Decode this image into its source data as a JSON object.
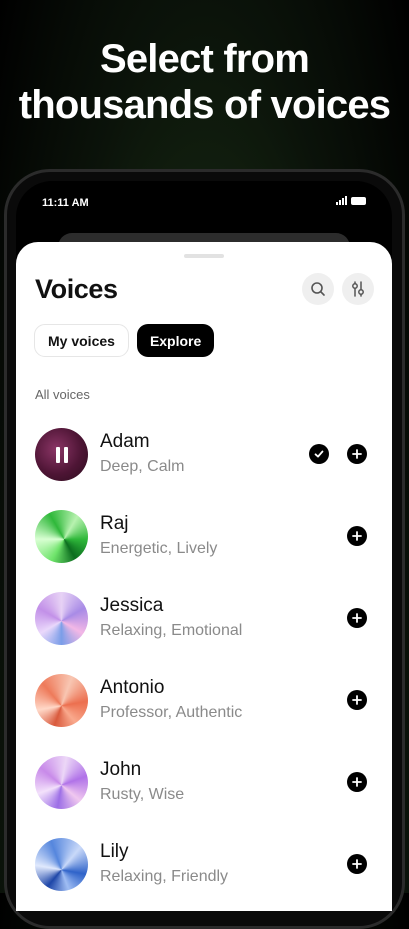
{
  "headline": {
    "line1": "Select from",
    "line2": "thousands of voices"
  },
  "status_bar": {
    "time": "11:11 AM"
  },
  "screen": {
    "title": "Voices",
    "search_icon": "search-icon",
    "filter_icon": "sliders-icon",
    "tabs": [
      {
        "label": "My voices",
        "active": false
      },
      {
        "label": "Explore",
        "active": true
      }
    ],
    "section_label": "All voices",
    "voices": [
      {
        "name": "Adam",
        "tags": "Deep, Calm",
        "playing": true,
        "added": true
      },
      {
        "name": "Raj",
        "tags": "Energetic, Lively",
        "playing": false,
        "added": false
      },
      {
        "name": "Jessica",
        "tags": "Relaxing, Emotional",
        "playing": false,
        "added": false
      },
      {
        "name": "Antonio",
        "tags": "Professor, Authentic",
        "playing": false,
        "added": false
      },
      {
        "name": "John",
        "tags": "Rusty, Wise",
        "playing": false,
        "added": false
      },
      {
        "name": "Lily",
        "tags": "Relaxing, Friendly",
        "playing": false,
        "added": false
      }
    ]
  },
  "colors": {
    "accent": "#000000",
    "background_green": "#2c5a22"
  }
}
